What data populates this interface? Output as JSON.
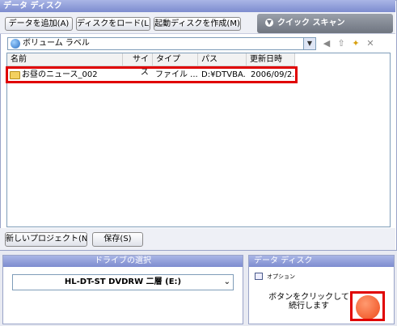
{
  "top_panel": {
    "title": "データ ディスク",
    "buttons": {
      "add_data": "データを追加(A)",
      "load_disc": "ディスクをロード(L)",
      "create_boot": "起動ディスクを作成(M)"
    },
    "quick_scan": "クイック スキャン",
    "volume_label": "ボリューム ラベル",
    "columns": [
      "名前",
      "サイズ",
      "タイプ",
      "パス",
      "更新日時"
    ],
    "rows": [
      {
        "name": "お昼のニュース_002",
        "size": "",
        "type": "ファイル ...",
        "path": "D:¥DTVBA...",
        "modified": "2006/09/2..."
      }
    ],
    "new_project": "新しいプロジェクト(N)",
    "save": "保存(S)"
  },
  "drive_panel": {
    "title": "ドライブの選択",
    "selected_drive": "HL-DT-ST DVDRW 二層 (E:)"
  },
  "action_panel": {
    "title": "データ ディスク",
    "option_label": "オプション",
    "instruction": "ボタンをクリックして続行します"
  },
  "colors": {
    "header_gradient_top": "#a9b5e6",
    "header_gradient_bottom": "#7d8ccf",
    "highlight": "#e00000",
    "go_button": "#ee4a1a"
  }
}
